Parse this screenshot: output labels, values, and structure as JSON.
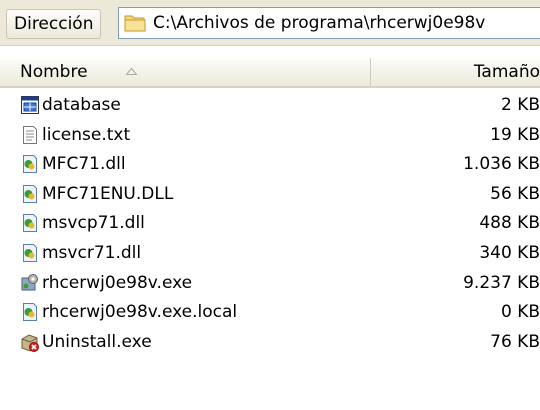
{
  "address_bar": {
    "label": "Dirección",
    "path": "C:\\Archivos de programa\\rhcerwj0e98v"
  },
  "columns": {
    "name": "Nombre",
    "size": "Tamaño"
  },
  "files": [
    {
      "name": "database",
      "size": "2 KB",
      "icon": "database-file-icon"
    },
    {
      "name": "license.txt",
      "size": "19 KB",
      "icon": "text-file-icon"
    },
    {
      "name": "MFC71.dll",
      "size": "1.036 KB",
      "icon": "dll-file-icon"
    },
    {
      "name": "MFC71ENU.DLL",
      "size": "56 KB",
      "icon": "dll-file-icon"
    },
    {
      "name": "msvcp71.dll",
      "size": "488 KB",
      "icon": "dll-file-icon"
    },
    {
      "name": "msvcr71.dll",
      "size": "340 KB",
      "icon": "dll-file-icon"
    },
    {
      "name": "rhcerwj0e98v.exe",
      "size": "9.237 KB",
      "icon": "exe-file-icon"
    },
    {
      "name": "rhcerwj0e98v.exe.local",
      "size": "0 KB",
      "icon": "dll-file-icon"
    },
    {
      "name": "Uninstall.exe",
      "size": "76 KB",
      "icon": "uninstall-exe-icon"
    }
  ]
}
